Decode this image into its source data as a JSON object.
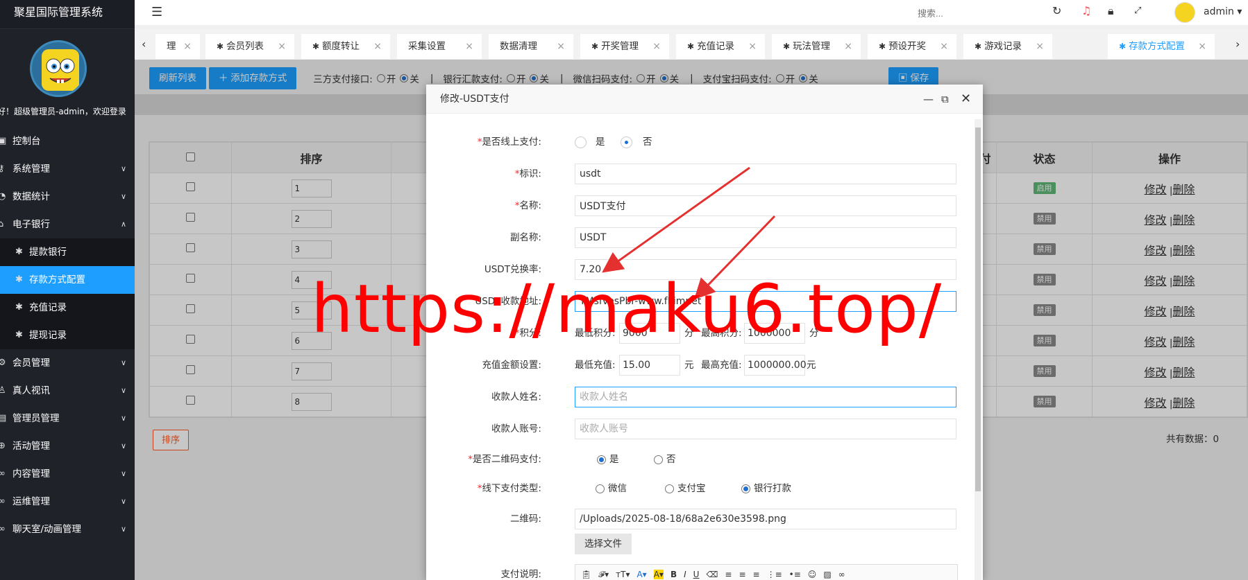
{
  "app": {
    "title": "聚星国际管理系统",
    "welcome": "好！超级管理员-admin，欢迎登录"
  },
  "sidebar": {
    "items": [
      {
        "label": "控制台",
        "icon": "monitor-icon",
        "chevron": ""
      },
      {
        "label": "系统管理",
        "icon": "key-icon",
        "chevron": "v"
      },
      {
        "label": "数据统计",
        "icon": "chart-icon",
        "chevron": "v"
      },
      {
        "label": "电子银行",
        "icon": "bank-icon",
        "chevron": "^"
      }
    ],
    "sub_items": [
      {
        "label": "提款银行"
      },
      {
        "label": "存款方式配置"
      },
      {
        "label": "充值记录"
      },
      {
        "label": "提现记录"
      }
    ],
    "items_after": [
      {
        "label": "会员管理",
        "chevron": "v"
      },
      {
        "label": "真人视讯",
        "chevron": "v"
      },
      {
        "label": "管理员管理",
        "chevron": "v"
      },
      {
        "label": "活动管理",
        "chevron": "v"
      },
      {
        "label": "内容管理",
        "chevron": "v"
      },
      {
        "label": "运维管理",
        "chevron": "v"
      },
      {
        "label": "聊天室/动画管理",
        "chevron": "v"
      }
    ]
  },
  "header": {
    "search_placeholder": "搜索...",
    "user": "admin"
  },
  "tabs": [
    {
      "label": "理",
      "icon": false
    },
    {
      "label": "会员列表",
      "icon": true
    },
    {
      "label": "额度转让",
      "icon": true
    },
    {
      "label": "采集设置",
      "icon": false
    },
    {
      "label": "数据清理",
      "icon": false
    },
    {
      "label": "开奖管理",
      "icon": true
    },
    {
      "label": "充值记录",
      "icon": true
    },
    {
      "label": "玩法管理",
      "icon": true
    },
    {
      "label": "预设开奖",
      "icon": true
    },
    {
      "label": "游戏记录",
      "icon": true
    },
    {
      "label": "存款方式配置",
      "icon": true
    }
  ],
  "toolbar": {
    "refresh": "刷新列表",
    "add": "添加存款方式",
    "third_party": "三方支付接口:",
    "bank_transfer": "银行汇款支付:",
    "wechat": "微信扫码支付:",
    "alipay": "支付宝扫码支付:",
    "on": "开",
    "off": "关",
    "sep": "|",
    "save": "保存"
  },
  "table": {
    "headers": {
      "sort": "排序",
      "pay": "付",
      "status": "状态",
      "ops": "操作"
    },
    "rows": [
      {
        "sort": "1",
        "status": "启用",
        "status_color": "#5fb878"
      },
      {
        "sort": "2",
        "status": "禁用",
        "status_color": "#8a8a8a"
      },
      {
        "sort": "3",
        "status": "禁用",
        "status_color": "#8a8a8a"
      },
      {
        "sort": "4",
        "status": "禁用",
        "status_color": "#8a8a8a"
      },
      {
        "sort": "5",
        "status": "禁用",
        "status_color": "#8a8a8a"
      },
      {
        "sort": "6",
        "status": "禁用",
        "status_color": "#8a8a8a"
      },
      {
        "sort": "7",
        "status": "禁用",
        "status_color": "#8a8a8a"
      },
      {
        "sort": "8",
        "status": "禁用",
        "status_color": "#8a8a8a"
      }
    ],
    "edit": "修改",
    "delete": "删除",
    "sep": "|",
    "sort_button": "排序",
    "total": "共有数据：0"
  },
  "modal": {
    "title": "修改-USDT支付",
    "online_label": "是否线上支付:",
    "yes": "是",
    "no": "否",
    "id_label": "标识:",
    "id_value": "usdt",
    "name_label": "名称:",
    "name_value": "USDT支付",
    "alias_label": "副名称:",
    "alias_value": "USDT",
    "rate_label": "USDT兑换率:",
    "rate_value": "7.20",
    "addr_label": "USDT收款地址:",
    "addr_value": "TMsfvesPbr-www.fkimnet",
    "points_label": "积分:",
    "min_points_label": "最低积分:",
    "min_points": "9000",
    "points_unit": "分",
    "max_points_label": "最高积分:",
    "max_points": "1000000",
    "recharge_label": "充值金额设置:",
    "min_recharge_label": "最低充值:",
    "min_recharge": "15.00",
    "yuan": "元",
    "max_recharge_label": "最高充值:",
    "max_recharge": "1000000.00",
    "payee_name_label": "收款人姓名:",
    "payee_name_ph": "收款人姓名",
    "payee_acct_label": "收款人账号:",
    "payee_acct_ph": "收款人账号",
    "qr_pay_label": "是否二维码支付:",
    "offline_type_label": "线下支付类型:",
    "wechat": "微信",
    "alipay": "支付宝",
    "bank": "银行打款",
    "qrcode_label": "二维码:",
    "qrcode_value": "/Uploads/2025-08-18/68a2e630e3598.png",
    "choose_file": "选择文件",
    "desc_label": "支付说明:"
  },
  "watermark": "https://maku6.top/"
}
